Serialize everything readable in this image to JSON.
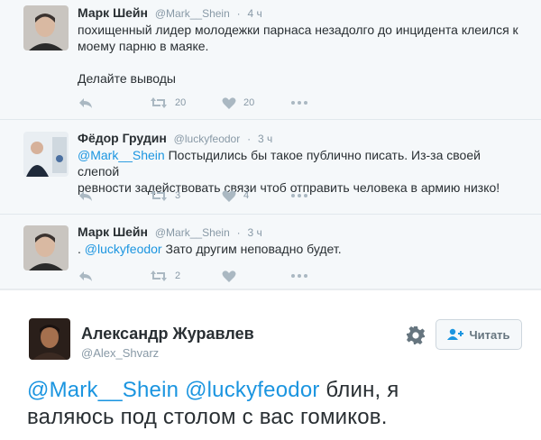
{
  "tweets": [
    {
      "name": "Марк Шейн",
      "handle": "@Mark__Shein",
      "time": "4 ч",
      "mention": "",
      "text_lines": [
        "похищенный лидер молодежки парнаса незадолго до инцидента клеился к",
        "моему парню в маяке."
      ],
      "text_extra": "Делайте выводы",
      "retweets": "20",
      "likes": "20"
    },
    {
      "name": "Фёдор Грудин",
      "handle": "@luckyfeodor",
      "time": "3 ч",
      "mention": "@Mark__Shein",
      "text_first": " Постыдились бы такое публично писать. Из-за своей слепой",
      "text_second": "ревности задействовать связи чтоб отправить человека в армию низко!",
      "retweets": "3",
      "likes": "4"
    },
    {
      "name": "Марк Шейн",
      "handle": "@Mark__Shein",
      "time": "3 ч",
      "prefix": ". ",
      "mention": "@luckyfeodor",
      "text_first": " Зато другим неповадно будет.",
      "retweets": "2",
      "likes": ""
    }
  ],
  "card": {
    "name": "Александр Журавлев",
    "handle": "@Alex_Shvarz",
    "follow_label": "Читать",
    "mention1": "@Mark__Shein",
    "mention2": "@luckyfeodor",
    "text_line1_tail": " блин, я",
    "text_line2": "валяюсь под столом с вас гомиков."
  },
  "icons": [
    "reply-icon",
    "retweet-icon",
    "like-icon",
    "more-icon",
    "gear-icon",
    "add-user-icon"
  ],
  "colors": {
    "mention": "#1b95e0",
    "muted": "#8899a6",
    "text": "#292f33"
  }
}
